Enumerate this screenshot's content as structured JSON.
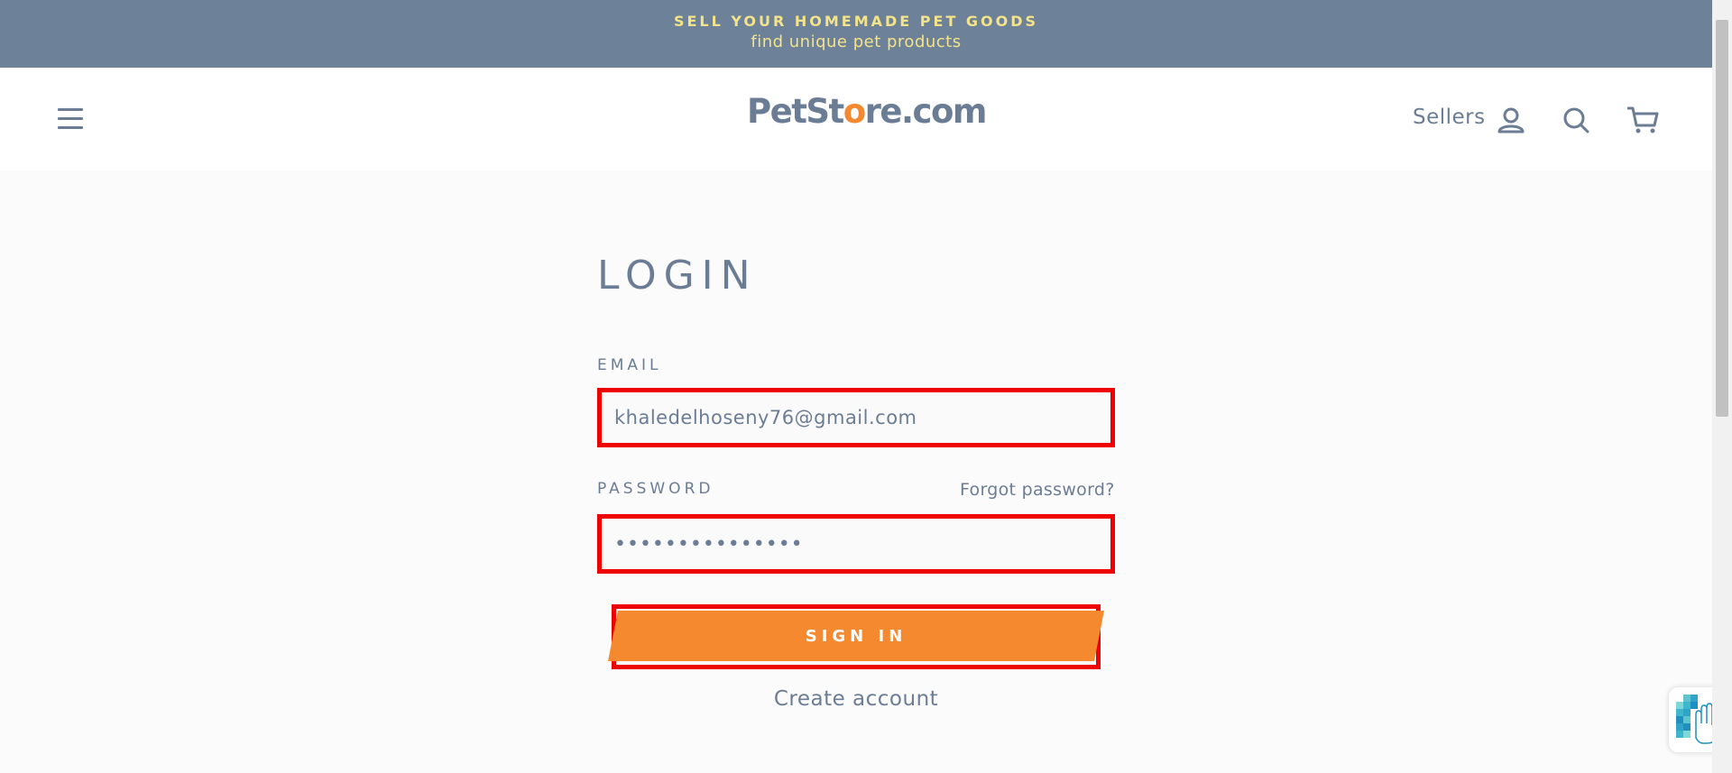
{
  "announcement": {
    "line1": "SELL YOUR HOMEMADE PET GOODS",
    "line2": "find unique pet products"
  },
  "header": {
    "logo": {
      "part1": "PetSt",
      "part2": "o",
      "part3": "re",
      "part4": ".com"
    },
    "sellers_label": "Sellers",
    "icons": [
      "menu-icon",
      "account-icon",
      "search-icon",
      "cart-icon"
    ]
  },
  "login": {
    "title": "LOGIN",
    "email_label": "EMAIL",
    "email_value": "khaledelhoseny76@gmail.com",
    "password_label": "PASSWORD",
    "password_masked": "•••••••••••••••",
    "forgot_label": "Forgot password?",
    "signin_label": "SIGN IN",
    "create_account_label": "Create account"
  },
  "colors": {
    "announcement_bg": "#6d8198",
    "announcement_text": "#f3e38a",
    "text": "#6b7d95",
    "accent": "#f5892f",
    "highlight_border": "#ee0000"
  }
}
